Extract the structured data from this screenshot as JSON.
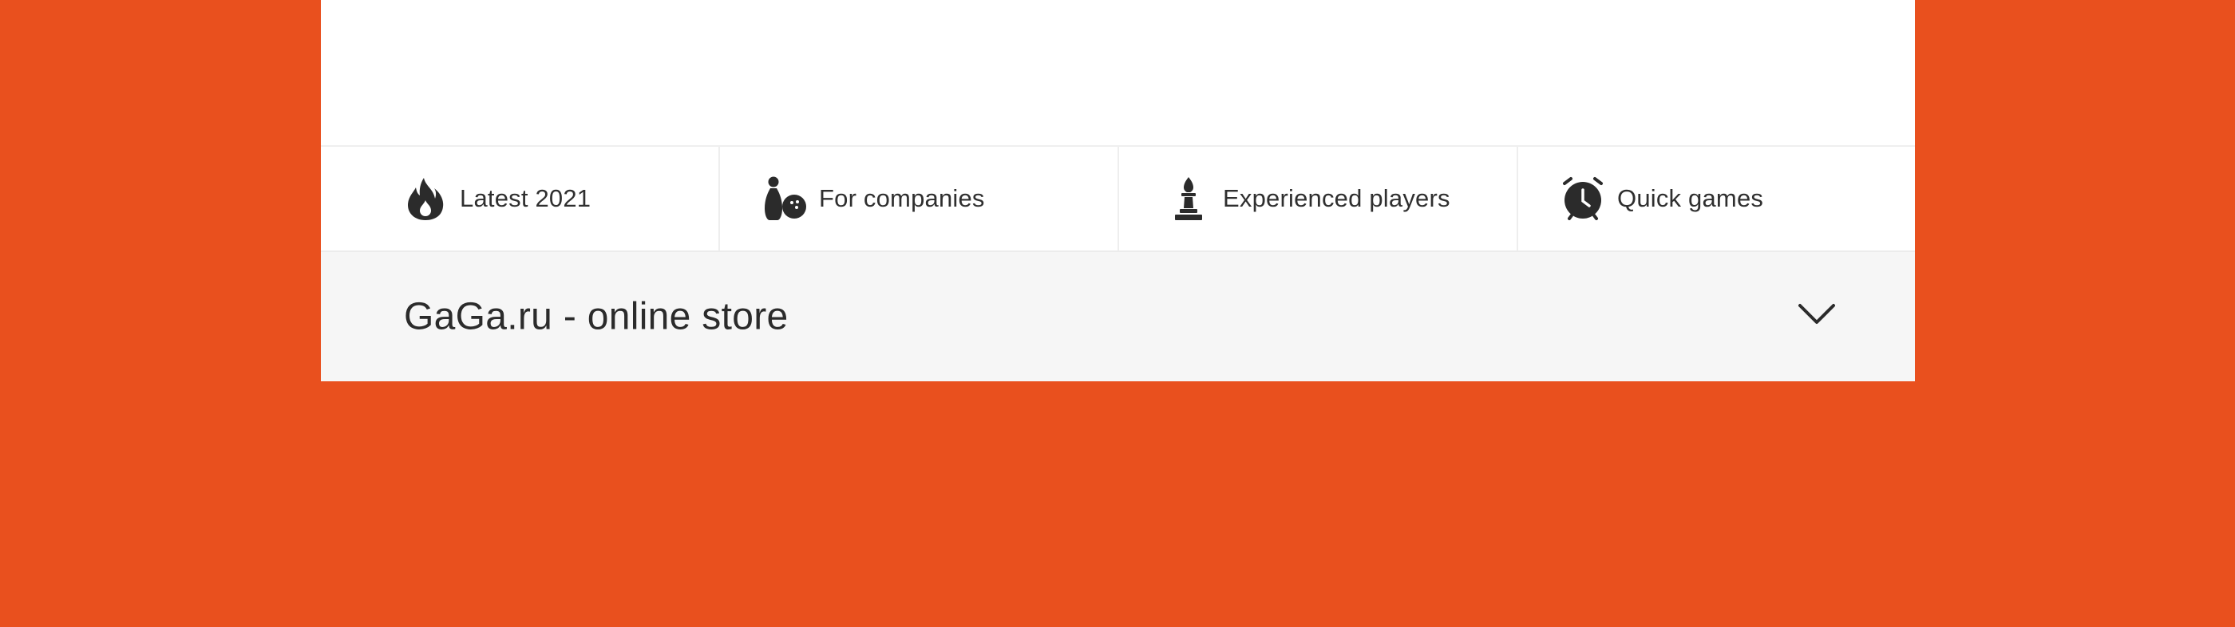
{
  "colors": {
    "page_background": "#E9501E",
    "panel_background": "#FFFFFF",
    "store_row_background": "#F6F6F6",
    "icon_color": "#2B2B2B",
    "text_color": "#2F2F2F"
  },
  "categories": [
    {
      "label": "Latest 2021",
      "icon": "flame-icon"
    },
    {
      "label": "For companies",
      "icon": "bowling-icon"
    },
    {
      "label": "Experienced players",
      "icon": "chess-bishop-icon"
    },
    {
      "label": "Quick games",
      "icon": "alarm-clock-icon"
    }
  ],
  "store_section": {
    "title": "GaGa.ru - online store",
    "toggle_icon": "chevron-down-icon",
    "expanded": false
  }
}
